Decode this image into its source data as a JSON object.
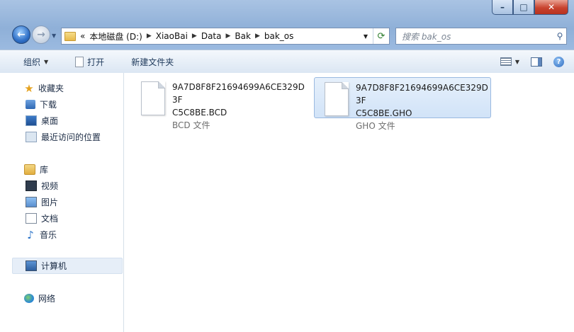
{
  "address": {
    "crumbs": [
      "«",
      "本地磁盘 (D:)",
      "XiaoBai",
      "Data",
      "Bak",
      "bak_os"
    ]
  },
  "search": {
    "placeholder": "搜索 bak_os"
  },
  "toolbar": {
    "organize": "组织",
    "open": "打开",
    "new_folder": "新建文件夹"
  },
  "sidebar": {
    "favorites": {
      "label": "收藏夹",
      "items": [
        "下载",
        "桌面",
        "最近访问的位置"
      ]
    },
    "libraries": {
      "label": "库",
      "items": [
        "视频",
        "图片",
        "文档",
        "音乐"
      ]
    },
    "computer": {
      "label": "计算机"
    },
    "network": {
      "label": "网络"
    }
  },
  "files": [
    {
      "name_line1": "9A7D8F8F21694699A6CE329D3F",
      "name_line2": "C5C8BE.BCD",
      "type": "BCD 文件",
      "selected": false
    },
    {
      "name_line1": "9A7D8F8F21694699A6CE329D3F",
      "name_line2": "C5C8BE.GHO",
      "type": "GHO 文件",
      "selected": true
    }
  ],
  "colors": {
    "selection": "#d1e3f8",
    "window_frame": "#9bbae0"
  }
}
